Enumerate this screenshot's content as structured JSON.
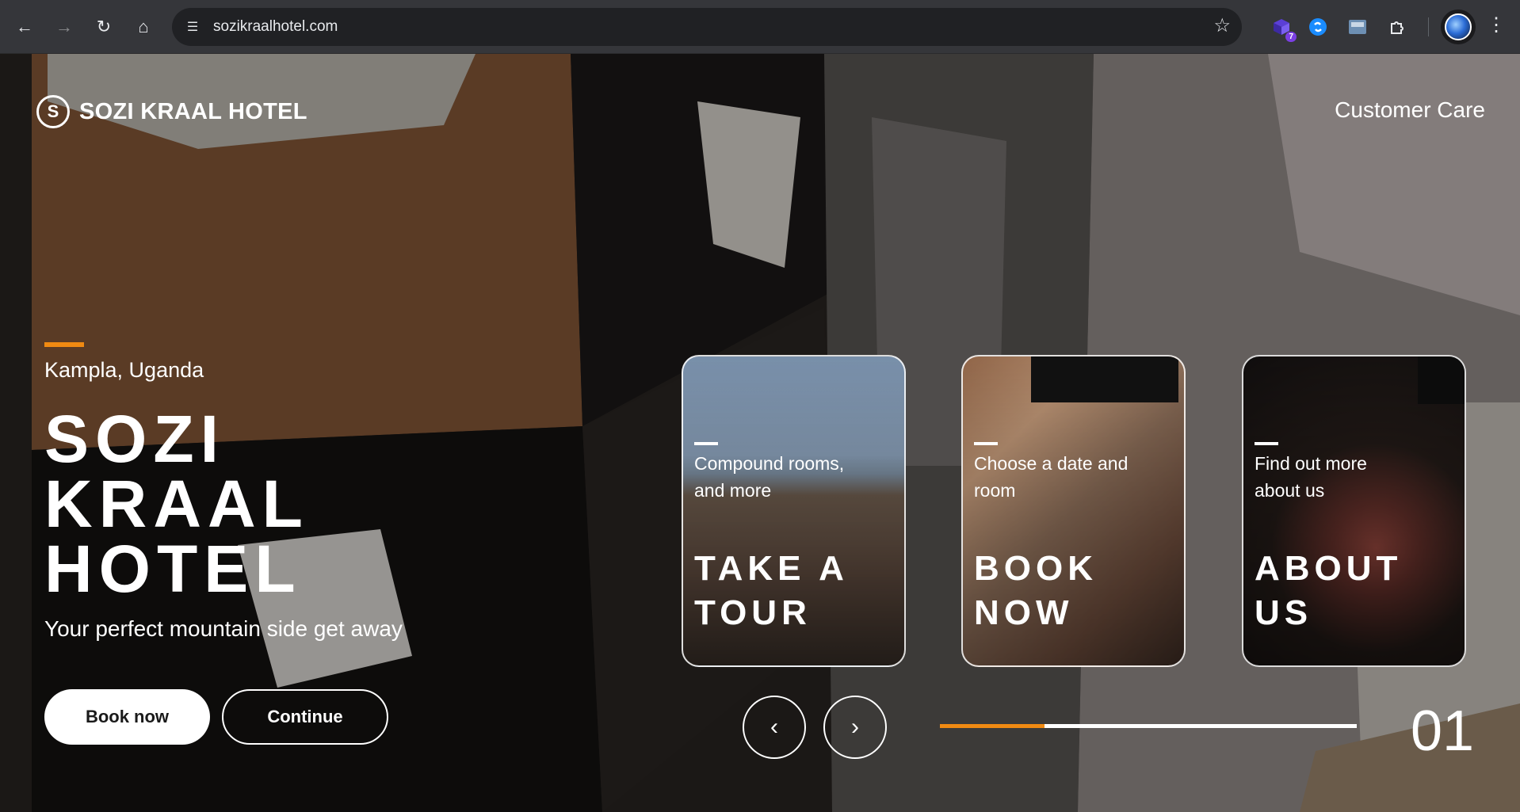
{
  "browser": {
    "url": "sozikraalhotel.com",
    "extension_badge": "7"
  },
  "header": {
    "brand": "SOZI KRAAL HOTEL",
    "logo_letter": "S",
    "customer_care": "Customer Care"
  },
  "hero": {
    "location": "Kampla, Uganda",
    "title_lines": [
      "SOZI",
      "KRAAL",
      "HOTEL"
    ],
    "tagline": "Your perfect mountain side get away",
    "book_now": "Book now",
    "continue": "Continue"
  },
  "cards": [
    {
      "caption": "Compound rooms, and more",
      "title_lines": [
        "TAKE A",
        "TOUR"
      ]
    },
    {
      "caption": "Choose a date and room",
      "title_lines": [
        "BOOK",
        "NOW"
      ]
    },
    {
      "caption": "Find out more about us",
      "title_lines": [
        "ABOUT",
        "US"
      ]
    }
  ],
  "slider": {
    "current": "01",
    "progress": 0.25
  },
  "colors": {
    "accent": "#f08a12",
    "chrome_bg": "#35363a",
    "omnibox_bg": "#202124"
  }
}
